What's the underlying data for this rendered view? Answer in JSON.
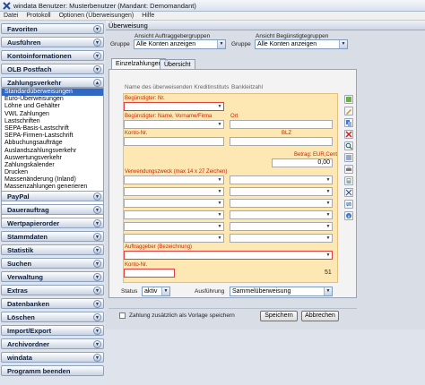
{
  "window": {
    "title": "windata Benutzer: Musterbenutzer (Mandant: Demomandant)"
  },
  "menu": [
    "Datei",
    "Protokoll",
    "Optionen (Überweisungen)",
    "Hilfe"
  ],
  "sidebar": {
    "sections_top": [
      "Favoriten",
      "Ausführen",
      "Kontoinformationen",
      "OLB Postfach",
      "Zahlungsverkehr"
    ],
    "zv_items": [
      "Standardüberweisungen",
      "Euro-Überweisungen",
      "Löhne und Gehälter",
      "VWL Zahlungen",
      "Lastschriften",
      "SEPA-Basis-Lastschrift",
      "SEPA-Firmen-Lastschrift",
      "Abbuchungsaufträge",
      "Auslandszahlungsverkehr",
      "Auswertungsverkehr",
      "Zahlungskalender",
      "Drucken",
      "Massenänderung (Inland)",
      "Massenzahlungen generieren"
    ],
    "sections_bottom": [
      "PayPal",
      "Dauerauftrag",
      "Wertpapierorder",
      "Stammdaten",
      "Statistik",
      "Suchen",
      "Verwaltung",
      "Extras",
      "Datenbanken",
      "Löschen",
      "Import/Export",
      "Archivordner",
      "windata",
      "Programm beenden"
    ]
  },
  "header": {
    "title": "Überweisung"
  },
  "filters": {
    "group_auftraggeber_label": "Ansicht Auftraggebergruppen",
    "group_beguenstigte_label": "Ansicht Begünstigtegruppen",
    "gruppe_label": "Gruppe",
    "gruppe1_value": "Alle Konten anzeigen",
    "gruppe2_value": "Alle Konten anzeigen"
  },
  "tabs": [
    "Einzelzahlungen",
    "Übersicht"
  ],
  "bank": {
    "name_label": "Name des überweisenden Kreditinstituts",
    "blz_label": "Bankleitzahl"
  },
  "form": {
    "beg_nr_label": "Begünstigter: Nr.",
    "beg_name_label": "Begünstigter: Name, Vorname/Firma",
    "ort_label": "Ort",
    "konto_nr_label": "Konto-Nr.",
    "blz_label": "BLZ",
    "betrag_label": "Betrag: EUR,Cent",
    "betrag_value": "0,00",
    "verwendungszweck_label": "Verwendungszweck (max 14 x 27 Zeichen)",
    "auftraggeber_label": "Auftraggeber (Bezeichnung)",
    "konto_nr2_label": "Konto-Nr.",
    "counter": "51"
  },
  "status": {
    "label": "Status",
    "value": "aktiv",
    "ausfuehrung_label": "Ausführung",
    "ausfuehrung_value": "Sammelüberweisung"
  },
  "footer": {
    "vorlage_label": "Zahlung zusätzlich als Vorlage speichern",
    "save_button": "Speichern",
    "cancel_button": "Abbrechen"
  },
  "colors": {
    "form_bg": "#fde7b3",
    "label_red": "#cc2200",
    "selected": "#3168c4"
  }
}
